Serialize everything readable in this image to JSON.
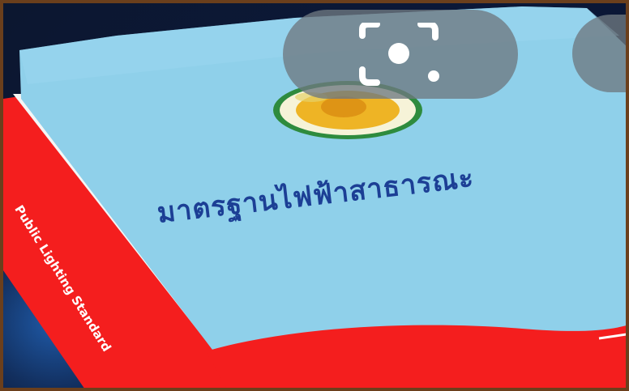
{
  "cover": {
    "title": "มาตรฐานไฟฟ้าสาธารณะ",
    "spine_title": "Public Lighting Standard"
  },
  "overlay": {
    "lens_icon": "google-lens-icon"
  },
  "colors": {
    "cover_blue": "#8fd0ea",
    "spine_red": "#f41e1e",
    "title_blue": "#1c3f95",
    "frame_brown": "#6b3f1c",
    "background_navy": "#0b1838"
  }
}
